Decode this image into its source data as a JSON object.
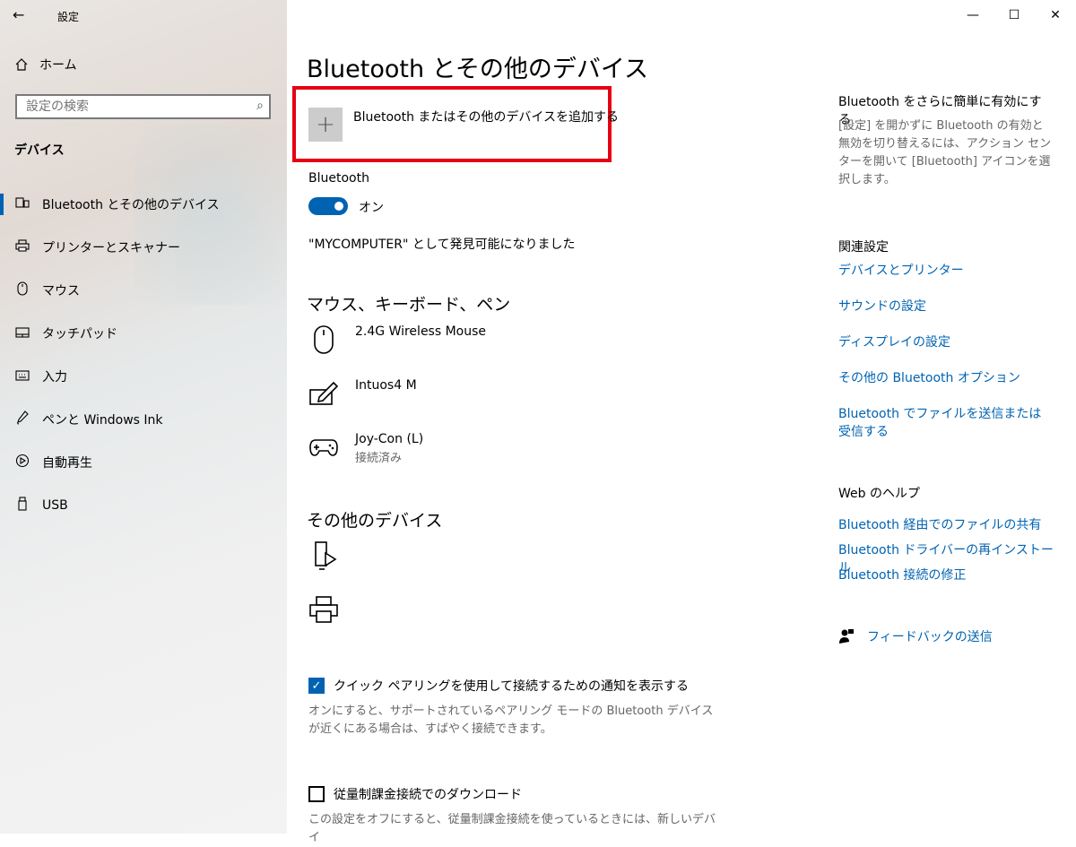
{
  "window": {
    "title": "設定",
    "controls": [
      "—",
      "☐",
      "✕"
    ]
  },
  "sidebar": {
    "home_label": "ホーム",
    "search_placeholder": "設定の検索",
    "section": "デバイス",
    "items": [
      {
        "label": "Bluetooth とその他のデバイス",
        "icon": "bluetooth-devices-icon",
        "active": true
      },
      {
        "label": "プリンターとスキャナー",
        "icon": "printer-icon"
      },
      {
        "label": "マウス",
        "icon": "mouse-icon"
      },
      {
        "label": "タッチパッド",
        "icon": "touchpad-icon"
      },
      {
        "label": "入力",
        "icon": "keyboard-icon"
      },
      {
        "label": "ペンと Windows Ink",
        "icon": "pen-icon"
      },
      {
        "label": "自動再生",
        "icon": "autoplay-icon"
      },
      {
        "label": "USB",
        "icon": "usb-icon"
      }
    ]
  },
  "main": {
    "title": "Bluetooth とその他のデバイス",
    "add_device_label": "Bluetooth またはその他のデバイスを追加する",
    "bluetooth_label": "Bluetooth",
    "toggle_state": "オン",
    "discoverable_text": "\"MYCOMPUTER\" として発見可能になりました",
    "group_input": "マウス、キーボード、ペン",
    "devices": [
      {
        "name": "2.4G Wireless Mouse",
        "status": "",
        "icon": "mouse-icon"
      },
      {
        "name": "Intuos4 M",
        "status": "",
        "icon": "pen-tablet-icon"
      },
      {
        "name": "Joy-Con (L)",
        "status": "接続済み",
        "icon": "gamepad-icon"
      }
    ],
    "group_other": "その他のデバイス",
    "other_devices": [
      {
        "icon": "media-device-icon"
      },
      {
        "icon": "printer-icon"
      }
    ],
    "swift_pair_label": "クイック ペアリングを使用して接続するための通知を表示する",
    "swift_pair_checked": true,
    "swift_pair_desc": "オンにすると、サポートされているペアリング モードの Bluetooth デバイスが近くにある場合は、すばやく接続できます。",
    "metered_label": "従量制課金接続でのダウンロード",
    "metered_checked": false,
    "metered_desc": "この設定をオフにすると、従量制課金接続を使っているときには、新しいデバイ"
  },
  "right": {
    "tip_title": "Bluetooth をさらに簡単に有効にする",
    "tip_text": "[設定] を開かずに Bluetooth の有効と無効を切り替えるには、アクション センターを開いて [Bluetooth] アイコンを選択します。",
    "related_title": "関連設定",
    "related_links": [
      "デバイスとプリンター",
      "サウンドの設定",
      "ディスプレイの設定",
      "その他の Bluetooth オプション",
      "Bluetooth でファイルを送信または受信する"
    ],
    "help_title": "Web のヘルプ",
    "help_links": [
      "Bluetooth 経由でのファイルの共有",
      "Bluetooth ドライバーの再インストール",
      "Bluetooth 接続の修正"
    ],
    "feedback_label": "フィードバックの送信"
  }
}
